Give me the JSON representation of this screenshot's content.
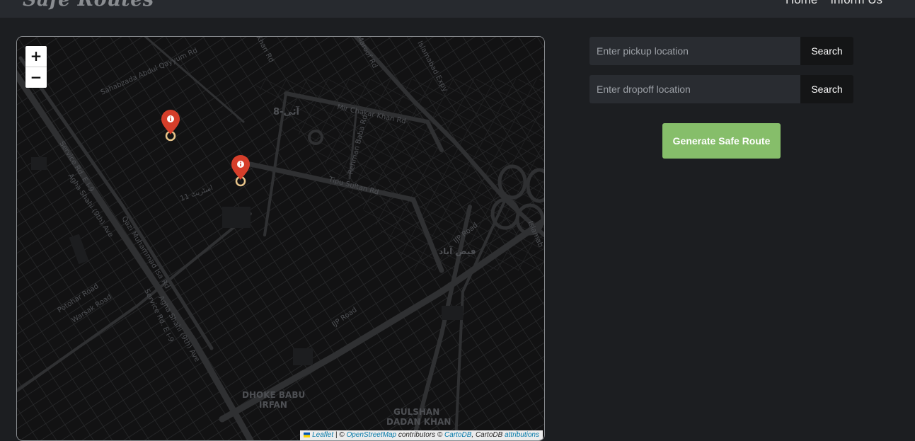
{
  "header": {
    "brand": "Safe Routes",
    "nav": [
      "Home",
      "Inform Us"
    ]
  },
  "map": {
    "zoom_in": "+",
    "zoom_out": "−",
    "labels": {
      "sector": "آئی-8",
      "faizabad": "فیض آباد",
      "mir_chakar": "Mir Chakar Khan Rd",
      "tipu": "Tipu Sultan Rd",
      "rehman": "Rehman Baba Rd",
      "ijp1": "IJP Road",
      "ijp2": "IJP Road",
      "agha1": "Agha Shahi (9th) Ave",
      "agha2": "Agha Shahi (9th) Ave",
      "service1": "Service Rd. E I-9",
      "service2": "Service Rd. E I-9",
      "qazi": "Qazi Muhammad Isa Rd",
      "islamabad_expy": "Islamabad Expy",
      "potohar": "Potohar Road",
      "warsak": "Warsak Road",
      "sahabzada": "Sahabzada Abdul Qayyum Rd",
      "dhoke1": "DHOKE BABU",
      "dhoke2": "IRFAN",
      "gulshan1": "GULSHAN",
      "gulshan2": "DADAN KHAN",
      "khan_rd": "Khan Rd",
      "maroof": "Maroof Rd",
      "islamabad_partial": "Islamab",
      "street": "اسٹریٹ 11"
    },
    "markers": [
      "pickup-marker",
      "dropoff-marker"
    ],
    "attribution": {
      "leaflet": "Leaflet",
      "sep1": " | © ",
      "osm": "OpenStreetMap",
      "mid": " contributors © ",
      "carto": "CartoDB",
      "mid2": ", CartoDB ",
      "attr": "attributions"
    }
  },
  "form": {
    "pickup_placeholder": "Enter pickup location",
    "dropoff_placeholder": "Enter dropoff location",
    "search_label": "Search",
    "generate_label": "Generate Safe Route"
  },
  "colors": {
    "background": "#1c1e21",
    "topbar": "#272a2f",
    "input_bg": "#292c31",
    "button_dark": "#141516",
    "generate_green": "#86be6a",
    "marker_red": "#d63e2a"
  }
}
